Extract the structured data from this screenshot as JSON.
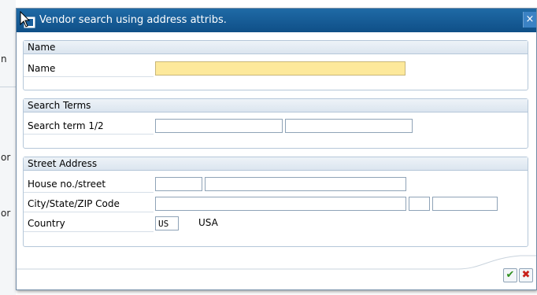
{
  "dialog": {
    "title": "Vendor search using address attribs.",
    "close_glyph": "×"
  },
  "background": {
    "fragments": [
      "n",
      "or",
      "or"
    ]
  },
  "groups": {
    "name": {
      "header": "Name",
      "name_label": "Name",
      "name_value": ""
    },
    "search_terms": {
      "header": "Search Terms",
      "term_label": "Search term 1/2",
      "term1_value": "",
      "term2_value": ""
    },
    "street_address": {
      "header": "Street Address",
      "house_label": "House no./street",
      "house_no_value": "",
      "street_value": "",
      "city_label": "City/State/ZIP Code",
      "city_value": "",
      "state_value": "",
      "zip_value": "",
      "country_label": "Country",
      "country_code": "US",
      "country_name": "USA"
    }
  },
  "buttons": {
    "ok_icon": "checkmark-icon",
    "ok_glyph": "✔",
    "cancel_icon": "cancel-x-icon",
    "cancel_glyph": "✖"
  },
  "colors": {
    "titlebar": "#1a5f9c",
    "required_field": "#fde99b",
    "group_border": "#b5c7d9"
  }
}
